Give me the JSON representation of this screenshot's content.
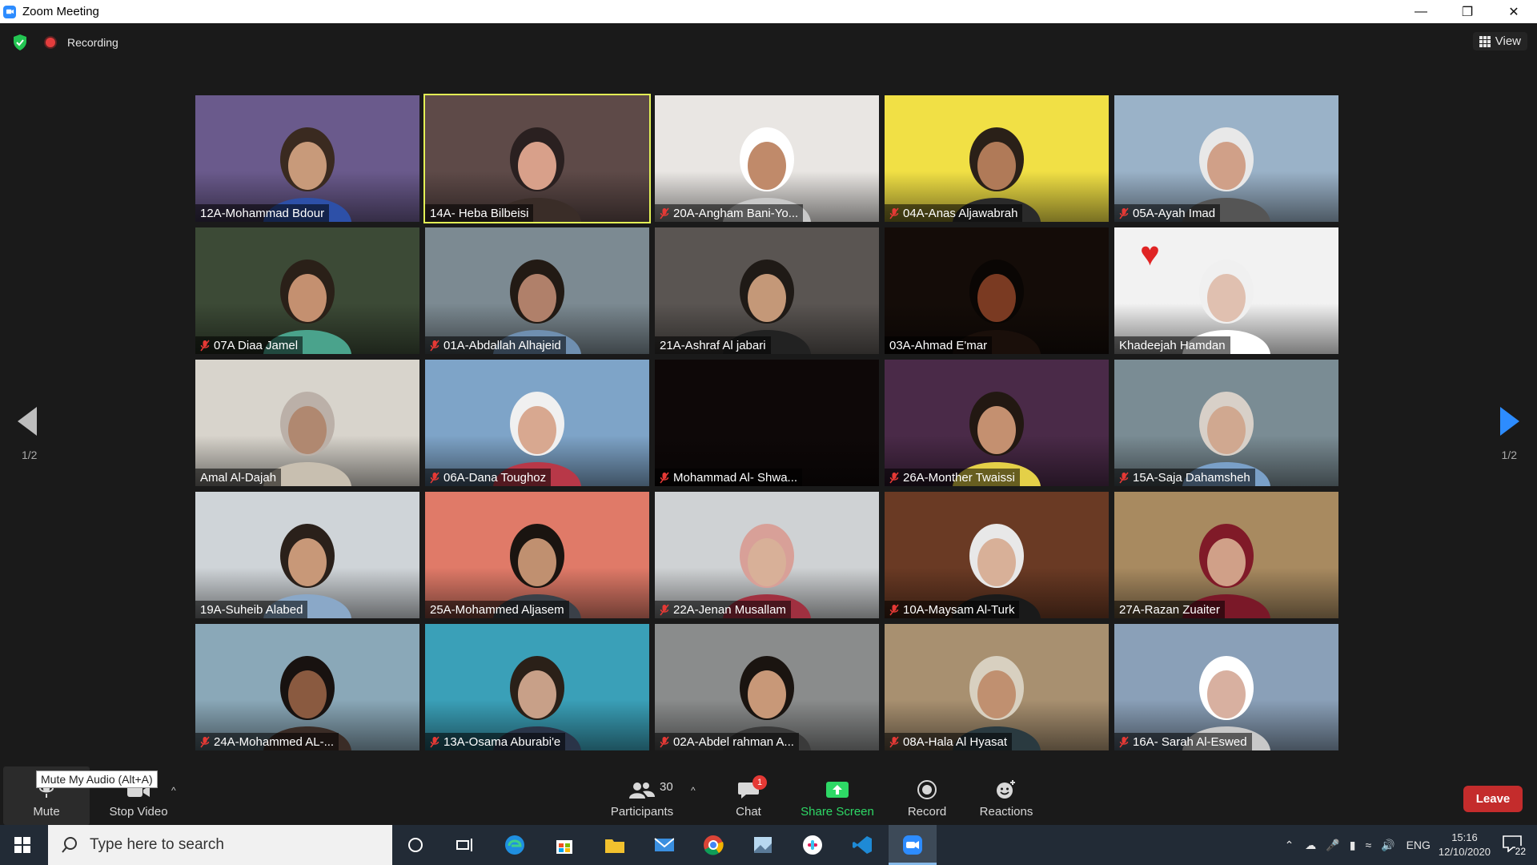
{
  "window": {
    "title": "Zoom Meeting"
  },
  "status": {
    "recording_label": "Recording",
    "view_label": "View"
  },
  "pagination": {
    "left_label": "1/2",
    "right_label": "1/2"
  },
  "participants": [
    {
      "name": "12A-Mohammad Bdour",
      "muted": false,
      "bg": "#6a5a8c",
      "shirt": "#2d50a8",
      "skin": "#c89a7a",
      "hair": "#3a2a20"
    },
    {
      "name": "14A- Heba Bilbeisi",
      "muted": false,
      "bg": "#5e4a48",
      "shirt": "#3a2d28",
      "skin": "#d8a08a",
      "hair": "#2a2020",
      "active": true
    },
    {
      "name": "20A-Angham Bani-Yo...",
      "muted": true,
      "bg": "#e9e6e3",
      "shirt": "#c9c9c9",
      "skin": "#c08a6a",
      "hair": "#ffffff"
    },
    {
      "name": "04A-Anas Aljawabrah",
      "muted": true,
      "bg": "#f1e045",
      "shirt": "#2a2a2a",
      "skin": "#b07a58",
      "hair": "#2a2018"
    },
    {
      "name": "05A-Ayah Imad",
      "muted": true,
      "bg": "#9ab2c8",
      "shirt": "#555555",
      "skin": "#d0a088",
      "hair": "#e8e8e8"
    },
    {
      "name": "07A Diaa Jamel",
      "muted": true,
      "bg": "#3c4a36",
      "shirt": "#4aa38c",
      "skin": "#c49070",
      "hair": "#2a2018"
    },
    {
      "name": "01A-Abdallah Alhajeid",
      "muted": true,
      "bg": "#7c8a92",
      "shirt": "#6f8fb0",
      "skin": "#b0806a",
      "hair": "#221a14"
    },
    {
      "name": "21A-Ashraf Al jabari",
      "muted": false,
      "bg": "#5a5552",
      "shirt": "#222222",
      "skin": "#c49878",
      "hair": "#1f1a16"
    },
    {
      "name": "03A-Ahmad E'mar",
      "muted": false,
      "bg": "#140c08",
      "shirt": "#1a0f0a",
      "skin": "#7a3a22",
      "hair": "#0a0604"
    },
    {
      "name": "Khadeejah Hamdan",
      "muted": false,
      "bg": "#f2f2f2",
      "shirt": "#ffffff",
      "skin": "#e0c0b0",
      "hair": "#f0f0f0",
      "heart": true
    },
    {
      "name": "Amal Al-Dajah",
      "muted": false,
      "bg": "#d8d4cc",
      "shirt": "#c8bfb0",
      "skin": "#b08870",
      "hair": "#bbb0a8"
    },
    {
      "name": "06A-Dana Toughoz",
      "muted": true,
      "bg": "#7ea4c8",
      "shirt": "#b83848",
      "skin": "#d8a890",
      "hair": "#f0f0f0"
    },
    {
      "name": "Mohammad Al- Shwa...",
      "muted": true,
      "bg": "#0e0808",
      "shirt": "#0e0808",
      "skin": "#0e0808",
      "hair": "#0e0808",
      "empty": true
    },
    {
      "name": "26A-Monther Twaissi",
      "muted": true,
      "bg": "#4a2a48",
      "shirt": "#e4d048",
      "skin": "#c49070",
      "hair": "#221812"
    },
    {
      "name": "15A-Saja Dahamsheh",
      "muted": true,
      "bg": "#7a8c94",
      "shirt": "#7aa0c8",
      "skin": "#d0a890",
      "hair": "#d8d0c8"
    },
    {
      "name": "19A-Suheib Alabed",
      "muted": false,
      "bg": "#cfd4d8",
      "shirt": "#8aa8c8",
      "skin": "#c89878",
      "hair": "#2a201a"
    },
    {
      "name": "25A-Mohammed Aljasem",
      "muted": false,
      "bg": "#e07a68",
      "shirt": "#3a4048",
      "skin": "#c09070",
      "hair": "#1a1410"
    },
    {
      "name": "22A-Jenan Musallam",
      "muted": true,
      "bg": "#cfd2d4",
      "shirt": "#a03040",
      "skin": "#d8b098",
      "hair": "#d8a098"
    },
    {
      "name": "10A-Maysam Al-Turk",
      "muted": true,
      "bg": "#6a3a24",
      "shirt": "#1a1a1a",
      "skin": "#d8b098",
      "hair": "#e8e8e8"
    },
    {
      "name": "27A-Razan Zuaiter",
      "muted": false,
      "bg": "#a88a60",
      "shirt": "#7a1828",
      "skin": "#d0a088",
      "hair": "#801a28"
    },
    {
      "name": "24A-Mohammed AL-...",
      "muted": true,
      "bg": "#8aa8b8",
      "shirt": "#3a2c26",
      "skin": "#8a5a40",
      "hair": "#181210"
    },
    {
      "name": "13A-Osama Aburabi'e",
      "muted": true,
      "bg": "#3aa0b8",
      "shirt": "#2a3448",
      "skin": "#c8a088",
      "hair": "#2a2018"
    },
    {
      "name": "02A-Abdel rahman A...",
      "muted": true,
      "bg": "#8a8c8c",
      "shirt": "#3a3a3a",
      "skin": "#c89878",
      "hair": "#1a1410"
    },
    {
      "name": "08A-Hala Al Hyasat",
      "muted": true,
      "bg": "#a89070",
      "shirt": "#2a3a40",
      "skin": "#c09070",
      "hair": "#d8d0c0"
    },
    {
      "name": "16A- Sarah Al-Eswed",
      "muted": true,
      "bg": "#8aa0b8",
      "shirt": "#c8c8c8",
      "skin": "#d8b0a0",
      "hair": "#ffffff"
    }
  ],
  "toolbar": {
    "mute_label": "Mute",
    "mute_tooltip": "Mute My Audio (Alt+A)",
    "stop_video_label": "Stop Video",
    "participants_label": "Participants",
    "participants_count": "30",
    "chat_label": "Chat",
    "chat_badge": "1",
    "share_label": "Share Screen",
    "record_label": "Record",
    "reactions_label": "Reactions",
    "leave_label": "Leave"
  },
  "taskbar": {
    "search_placeholder": "Type here to search",
    "lang": "ENG",
    "time": "15:16",
    "date": "12/10/2020",
    "notif_count": "22"
  }
}
